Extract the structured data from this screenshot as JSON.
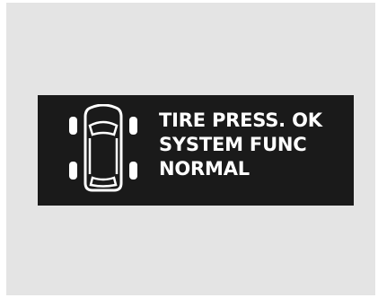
{
  "display": {
    "icon": "tire-pressure-car-icon",
    "lines": [
      "TIRE PRESS. OK",
      "SYSTEM FUNC",
      "NORMAL"
    ],
    "colors": {
      "background": "#e4e4e4",
      "screen": "#1a1a1a",
      "text": "#ffffff"
    }
  }
}
